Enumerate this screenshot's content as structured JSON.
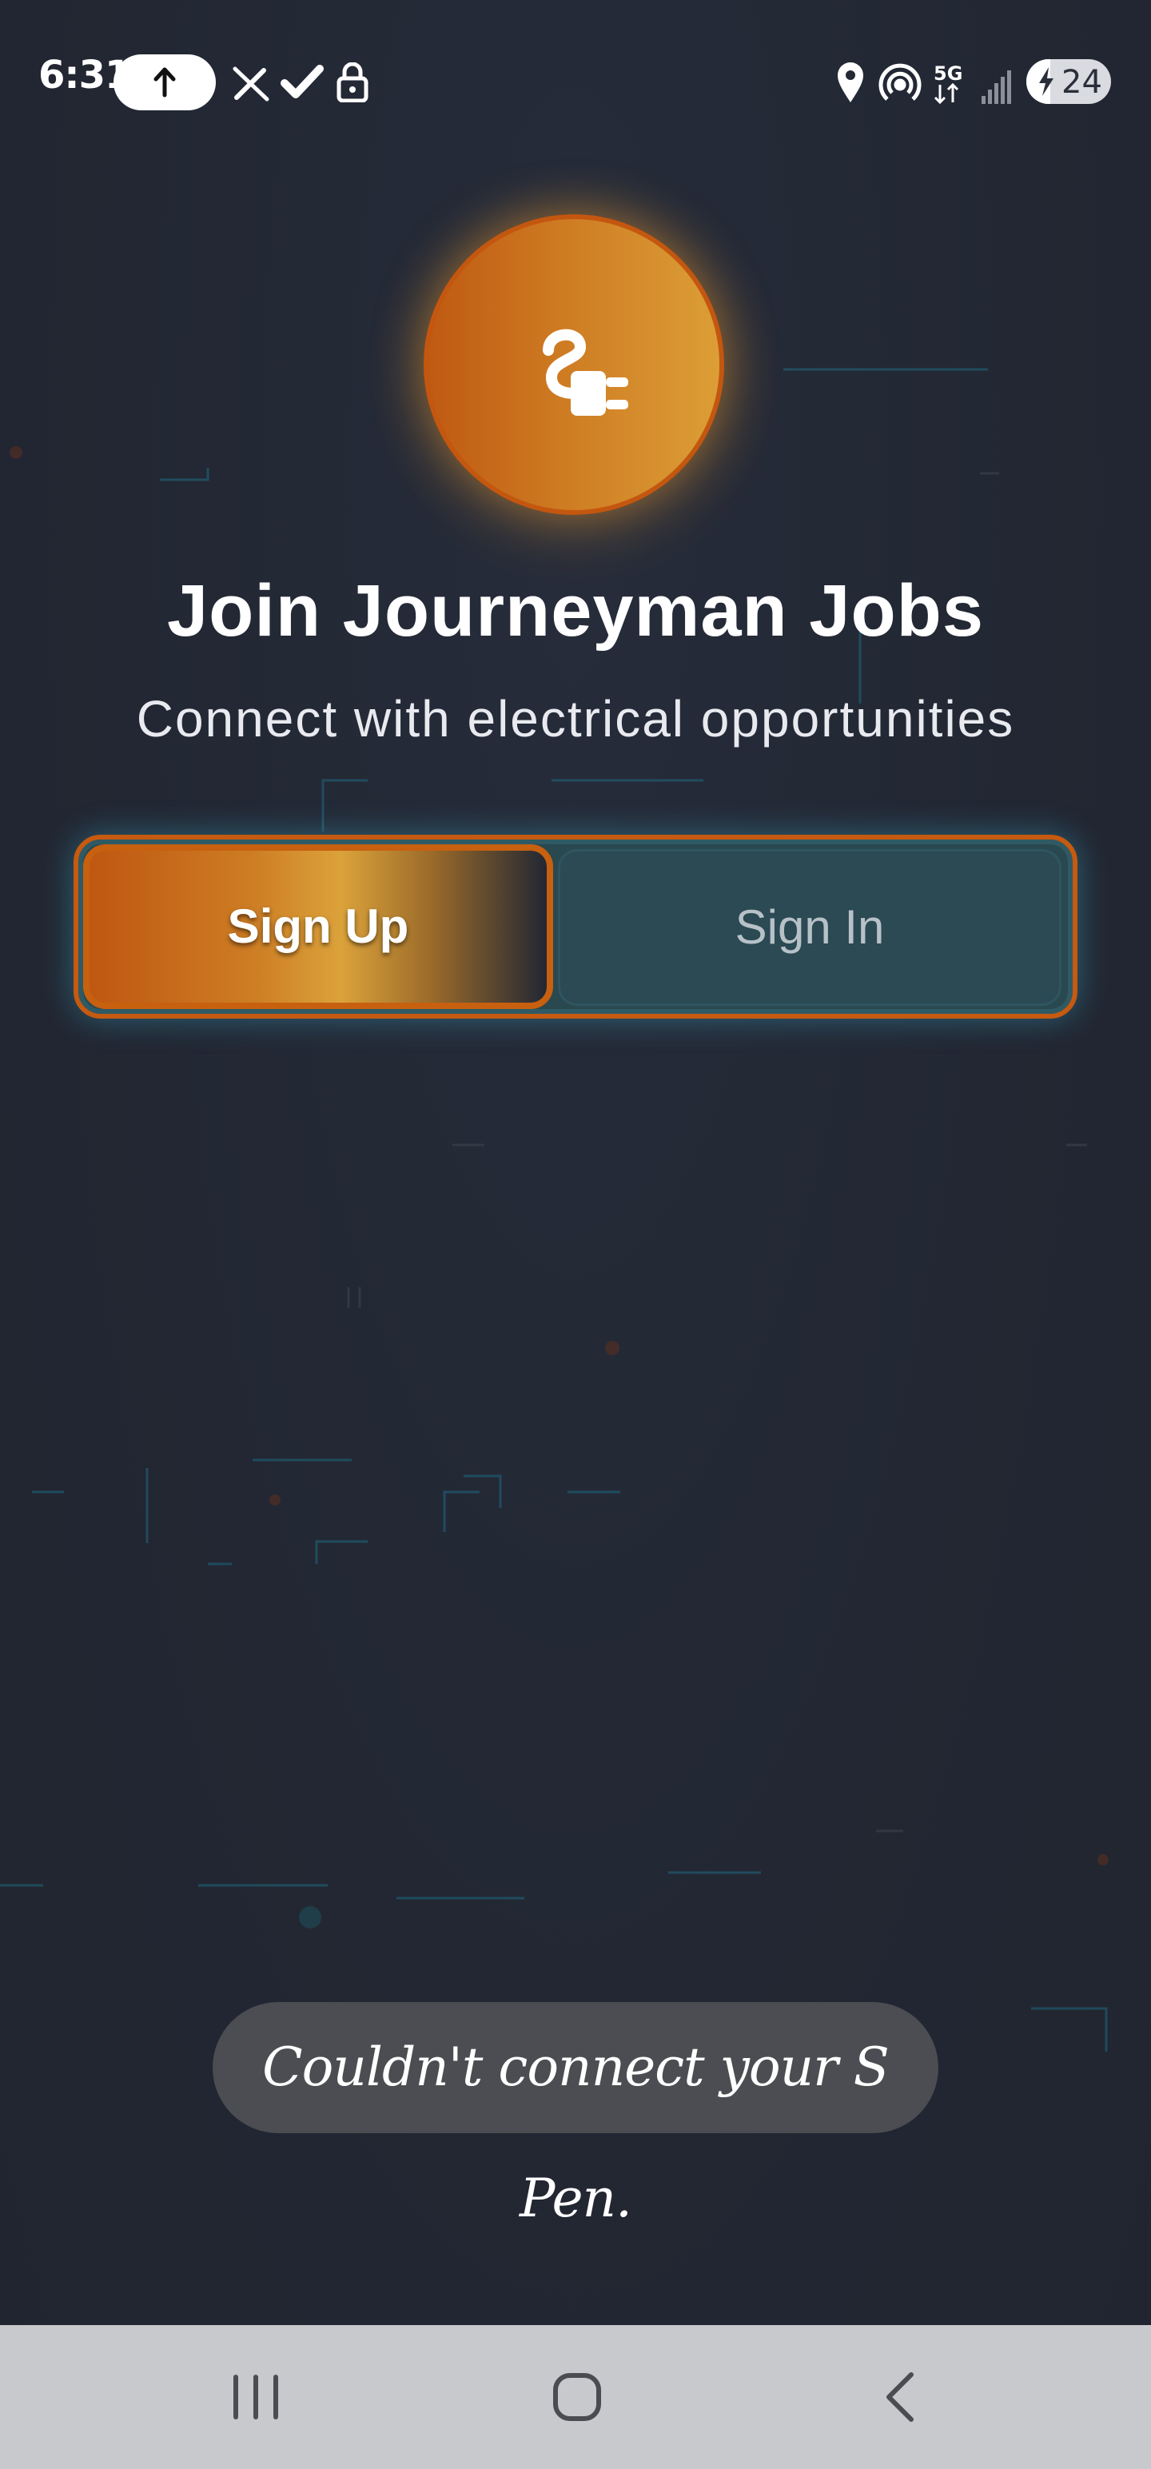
{
  "status_bar": {
    "time": "6:31",
    "battery_level": "24",
    "left_icons": [
      "upload-icon",
      "pen-off-icon",
      "check-icon",
      "lock-icon"
    ],
    "right_icons": [
      "location-icon",
      "hotspot-icon",
      "5g-icon",
      "signal-icon",
      "battery-charging-icon"
    ]
  },
  "app": {
    "logo_icon": "electric-plug-icon",
    "title": "Join Journeyman Jobs",
    "subtitle": "Connect with electrical opportunities",
    "tabs": [
      {
        "label": "Sign Up",
        "selected": true
      },
      {
        "label": "Sign In",
        "selected": false
      }
    ]
  },
  "toast": {
    "message": "Couldn't connect your S Pen."
  },
  "nav_bar": {
    "buttons": [
      "recent-apps-icon",
      "home-icon",
      "back-icon"
    ]
  },
  "colors": {
    "background": "#232834",
    "accent_orange": "#c55a10",
    "accent_gold": "#dba23a",
    "tab_teal": "#2b4a53",
    "toast_bg": "#4b4d52",
    "nav_bg": "#c8c9cc"
  }
}
